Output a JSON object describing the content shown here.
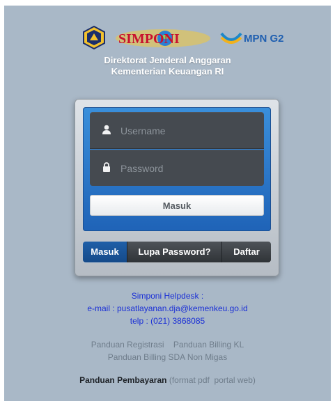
{
  "header": {
    "logo_simponi": "SIMPONI",
    "logo_mpn": "MPN G2",
    "title_line1": "Direktorat Jenderal Anggaran",
    "title_line2": "Kementerian Keuangan RI"
  },
  "login": {
    "username_placeholder": "Username",
    "password_placeholder": "Password",
    "submit_label": "Masuk"
  },
  "tabs": [
    {
      "label": "Masuk",
      "active": true
    },
    {
      "label": "Lupa Password?",
      "active": false
    },
    {
      "label": "Daftar",
      "active": false
    }
  ],
  "helpdesk": {
    "title": "Simponi Helpdesk :",
    "email": "e-mail : pusatlayanan.dja@kemenkeu.go.id",
    "phone": "telp : (021) 3868085"
  },
  "guides": {
    "registrasi": "Panduan Registrasi",
    "billing_kl": "Panduan Billing KL",
    "billing_sda": "Panduan Billing SDA Non Migas"
  },
  "payment": {
    "label": "Panduan Pembayaran",
    "open": "(",
    "pdf": "format pdf",
    "web": "portal web",
    "close": ")"
  },
  "colors": {
    "background": "#a9b8c7",
    "accent_blue": "#1f63b7",
    "helpdesk_text": "#1a2fd6"
  }
}
